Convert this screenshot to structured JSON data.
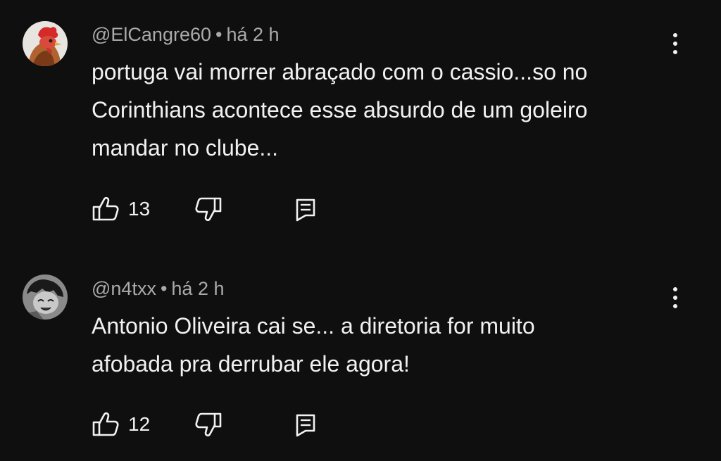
{
  "comments": [
    {
      "author": "@ElCangre60",
      "separator": "•",
      "time": "há 2 h",
      "avatar_icon": "rooster-avatar",
      "text_lines": [
        "portuga vai morrer abraçado com o cassio...so no",
        "Corinthians acontece esse absurdo de um goleiro",
        "mandar no clube..."
      ],
      "likes": "13"
    },
    {
      "author": "@n4txx",
      "separator": "•",
      "time": "há 2 h",
      "avatar_icon": "anime-sketch-avatar",
      "text_lines": [
        "Antonio Oliveira cai se... a diretoria for muito",
        "afobada pra derrubar ele agora!"
      ],
      "likes": "12"
    }
  ],
  "colors": {
    "background": "#0f0f0f",
    "text": "#f1f1f1",
    "meta": "#aaaaaa"
  }
}
